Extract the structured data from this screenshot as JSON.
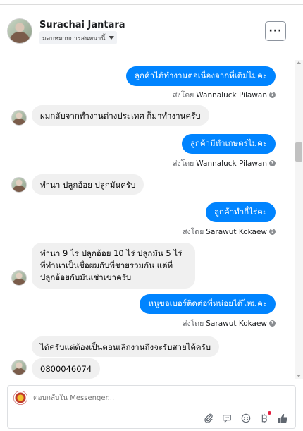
{
  "header": {
    "name": "Surachai Jantara",
    "assign_label": "มอบหมายการสนทนานี้",
    "more_label": "···"
  },
  "messages": [
    {
      "direction": "out",
      "text": "ลูกค้าได้ทำงานต่อเนื่องจากที่เดิมไมคะ",
      "sent_by_prefix": "ส่งโดย",
      "agent": "Wannaluck Pilawan"
    },
    {
      "direction": "in",
      "text": "ผมกลับจากทำงานต่างประเทศ ก็มาทำงานครับ"
    },
    {
      "direction": "out",
      "text": "ลูกค้ามีทำเกษตรไมคะ",
      "sent_by_prefix": "ส่งโดย",
      "agent": "Wannaluck Pilawan"
    },
    {
      "direction": "in",
      "text": "ทำนา  ปลูกอ้อย  ปลูกมันครับ"
    },
    {
      "direction": "out",
      "text": "ลูกค้าทำกี่ไร่คะ",
      "sent_by_prefix": "ส่งโดย",
      "agent": "Sarawut Kokaew"
    },
    {
      "direction": "in",
      "text": "ทำนา 9 ไร่  ปลูกอ้อย 10 ไร่  ปลูกมัน 5 ไร่ ที่ทำนาเป็นชื่อผมกับพี่ชายรวมกัน  แต่ที่ปลูกอ้อยกับมันเช่าเขาครับ"
    },
    {
      "direction": "out",
      "text": "หนูขอเบอร์ติดต่อพี่หน่อยได้ไหมคะ",
      "sent_by_prefix": "ส่งโดย",
      "agent": "Sarawut Kokaew"
    },
    {
      "direction": "in",
      "text": "ได้ครับแต่ต้องเป็นตอนเลิกงานถึงจะรับสายได้ครับ"
    },
    {
      "direction": "in",
      "text": "0800046074"
    }
  ],
  "composer": {
    "placeholder": "ตอบกลับใน Messenger..."
  },
  "icons": [
    "attach-icon",
    "saved-reply-icon",
    "emoji-icon",
    "payment-icon",
    "like-icon"
  ],
  "colors": {
    "outgoing_bubble": "#0084ff",
    "incoming_bubble": "#f0f0f0",
    "like": "#65676b"
  }
}
